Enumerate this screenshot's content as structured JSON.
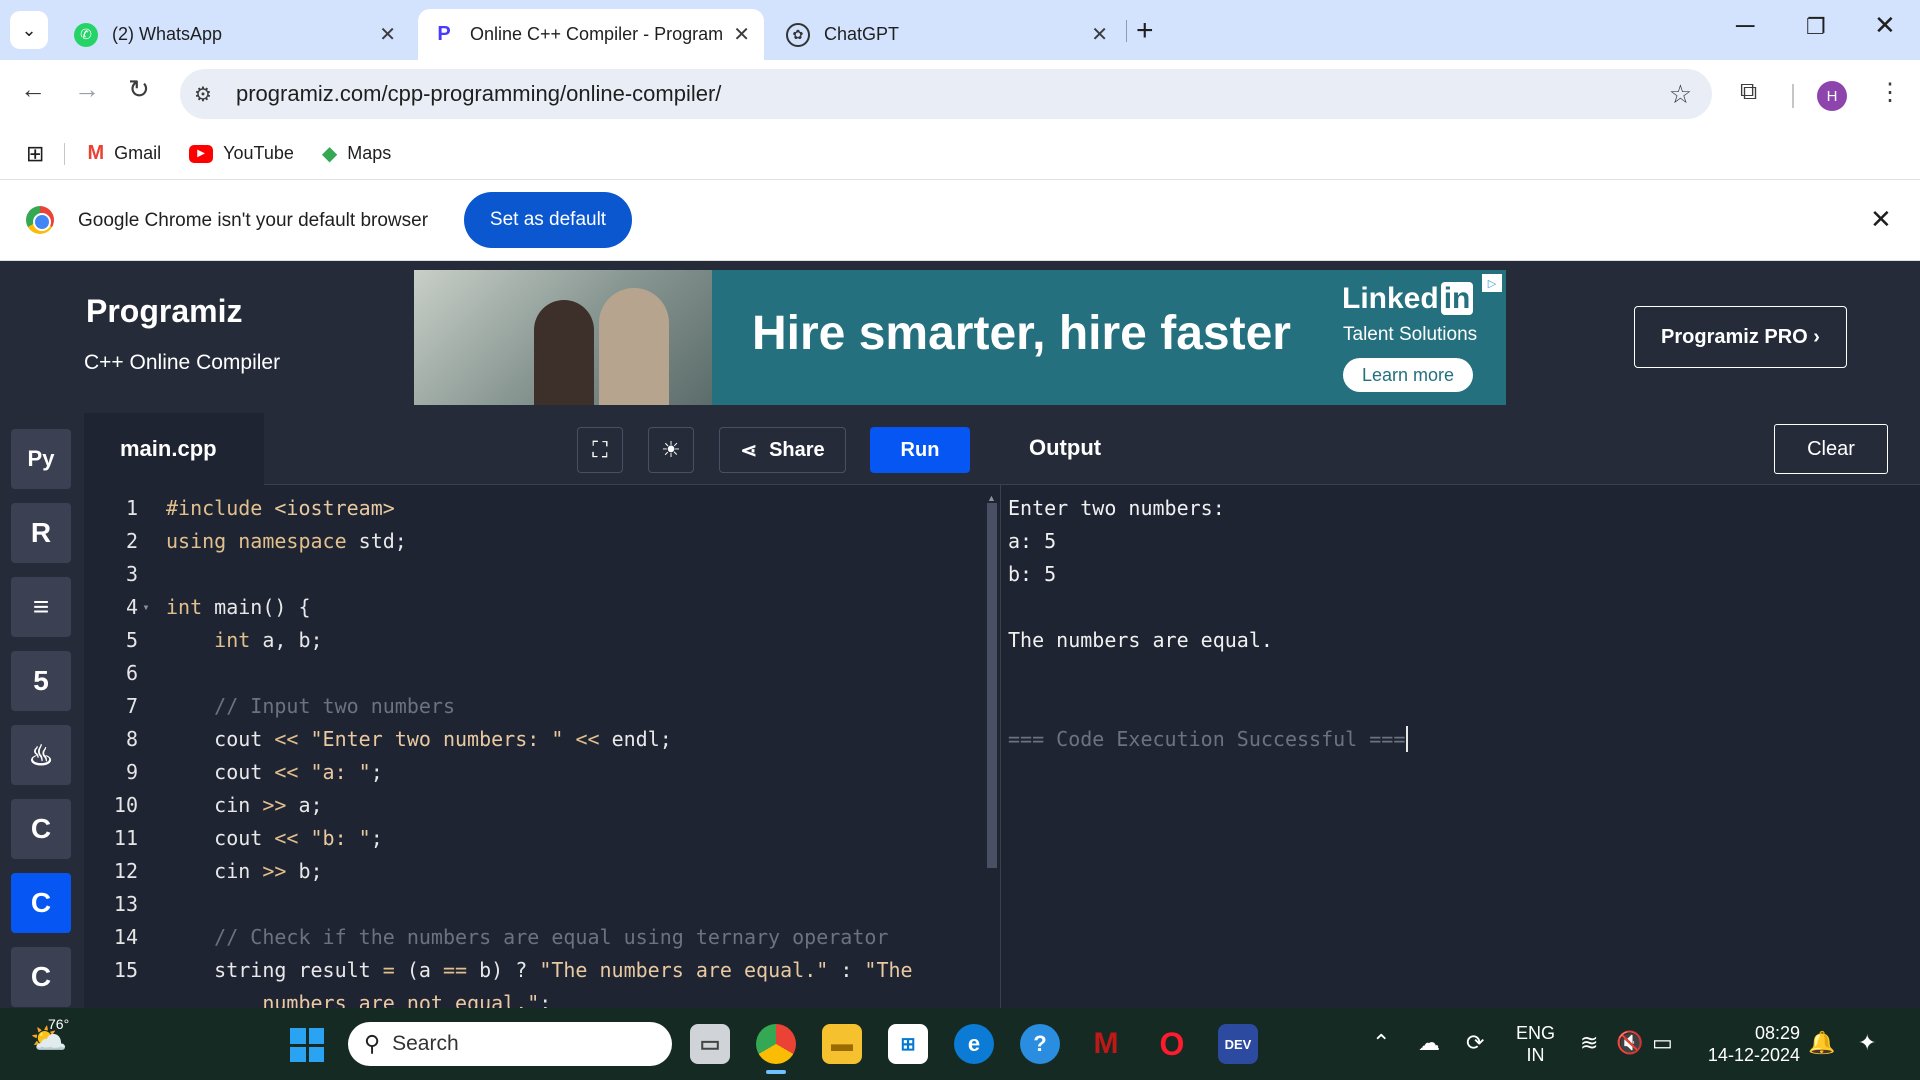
{
  "browser": {
    "tabs": [
      {
        "title": "(2) WhatsApp",
        "icon": "whatsapp-icon"
      },
      {
        "title": "Online C++ Compiler - Program",
        "icon": "programiz-icon",
        "active": true
      },
      {
        "title": "ChatGPT",
        "icon": "chatgpt-icon"
      }
    ],
    "url": "programiz.com/cpp-programming/online-compiler/",
    "profile_initial": "H",
    "bookmarks": [
      {
        "label": "Gmail",
        "icon": "gmail-icon"
      },
      {
        "label": "YouTube",
        "icon": "youtube-icon"
      },
      {
        "label": "Maps",
        "icon": "maps-icon"
      }
    ],
    "infobar": {
      "message": "Google Chrome isn't your default browser",
      "button": "Set as default"
    }
  },
  "site": {
    "logo": "Programiz",
    "subtitle": "C++ Online Compiler",
    "pro_button": "Programiz PRO ›",
    "ad": {
      "headline": "Hire smarter, hire faster",
      "brand": "Linked",
      "brand_in": "in",
      "tagline": "Talent Solutions",
      "cta": "Learn more"
    }
  },
  "sidebar": {
    "languages": [
      {
        "name": "python",
        "glyph": "Py"
      },
      {
        "name": "r",
        "glyph": "R"
      },
      {
        "name": "sql",
        "glyph": "≡"
      },
      {
        "name": "html",
        "glyph": "5"
      },
      {
        "name": "java",
        "glyph": "♨"
      },
      {
        "name": "c",
        "glyph": "C"
      },
      {
        "name": "cpp",
        "glyph": "C",
        "active": true
      },
      {
        "name": "csharp",
        "glyph": "C"
      }
    ]
  },
  "editor": {
    "filename": "main.cpp",
    "share_label": "Share",
    "run_label": "Run",
    "lines": [
      {
        "n": "1",
        "html": "<span class=\"kw\">#include</span> <span class=\"str\">&lt;iostream&gt;</span>"
      },
      {
        "n": "2",
        "html": "<span class=\"kw\">using namespace</span> std;"
      },
      {
        "n": "3",
        "html": ""
      },
      {
        "n": "4",
        "html": "<span class=\"kw\">int</span> main() {",
        "fold": true
      },
      {
        "n": "5",
        "html": "    <span class=\"kw\">int</span> a, b;"
      },
      {
        "n": "6",
        "html": ""
      },
      {
        "n": "7",
        "html": "    <span class=\"cm\">// Input two numbers</span>"
      },
      {
        "n": "8",
        "html": "    cout <span class=\"op\">&lt;&lt;</span> <span class=\"str\">\"Enter two numbers: \"</span> <span class=\"op\">&lt;&lt;</span> endl;"
      },
      {
        "n": "9",
        "html": "    cout <span class=\"op\">&lt;&lt;</span> <span class=\"str\">\"a: \"</span>;"
      },
      {
        "n": "10",
        "html": "    cin <span class=\"op\">&gt;&gt;</span> a;"
      },
      {
        "n": "11",
        "html": "    cout <span class=\"op\">&lt;&lt;</span> <span class=\"str\">\"b: \"</span>;"
      },
      {
        "n": "12",
        "html": "    cin <span class=\"op\">&gt;&gt;</span> b;"
      },
      {
        "n": "13",
        "html": ""
      },
      {
        "n": "14",
        "html": "    <span class=\"cm\">// Check if the numbers are equal using ternary operator</span>"
      },
      {
        "n": "15",
        "html": "    string result <span class=\"op\">=</span> (a <span class=\"op\">==</span> b) ? <span class=\"str\">\"The numbers are equal.\"</span> : <span class=\"str\">\"The</span>"
      },
      {
        "n": "",
        "html": "        <span class=\"str\">numbers are not equal.\"</span>;"
      }
    ]
  },
  "output": {
    "title": "Output",
    "clear_label": "Clear",
    "lines": [
      {
        "text": "Enter two numbers:"
      },
      {
        "text": "a: 5"
      },
      {
        "text": "b: 5"
      },
      {
        "text": ""
      },
      {
        "text": "The numbers are equal."
      },
      {
        "text": ""
      },
      {
        "text": ""
      },
      {
        "text": "=== Code Execution Successful ===",
        "muted": true,
        "caret": true
      }
    ]
  },
  "taskbar": {
    "weather_temp": "76°",
    "search_placeholder": "Search",
    "apps": [
      "task-view",
      "chrome",
      "file-explorer",
      "microsoft-store",
      "edge",
      "get-help",
      "mcafee",
      "opera",
      "dev-cpp"
    ],
    "lang_line1": "ENG",
    "lang_line2": "IN",
    "time": "08:29",
    "date": "14-12-2024"
  }
}
